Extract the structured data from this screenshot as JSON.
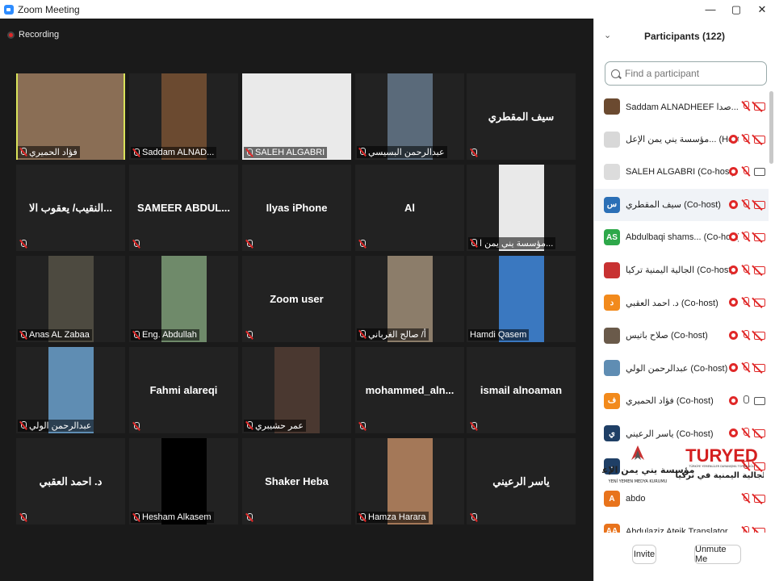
{
  "window": {
    "title": "Zoom Meeting",
    "minimize": "—",
    "maximize": "▢",
    "close": "✕"
  },
  "recording": {
    "label": "Recording"
  },
  "tiles": [
    {
      "name": "فؤاد الحميري",
      "kind": "photo",
      "photo": "#8a6e55",
      "active": true
    },
    {
      "name": "Saddam ALNAD...",
      "kind": "photo",
      "photo": "#6b4a30"
    },
    {
      "name": "SALEH ALGABRI",
      "kind": "slide",
      "photo": "#eaeaea"
    },
    {
      "name": "عبدالرحمن البسيسي",
      "kind": "photo",
      "photo": "#5a6a7a"
    },
    {
      "name": "سيف المقطري",
      "kind": "text"
    },
    {
      "name": "النقيب/ يعقوب الا...",
      "kind": "text"
    },
    {
      "name": "SAMEER ABDUL...",
      "kind": "text"
    },
    {
      "name": "Ilyas iPhone",
      "kind": "text"
    },
    {
      "name": "Al",
      "kind": "text"
    },
    {
      "name": "مؤسسة يني يمن ا...",
      "kind": "photo",
      "photo": "#e9e9e9"
    },
    {
      "name": "Anas AL Zabaa",
      "kind": "photo",
      "photo": "#4d4a40"
    },
    {
      "name": "Eng. Abdullah",
      "kind": "photo",
      "photo": "#6f8a6a"
    },
    {
      "name": "Zoom user",
      "kind": "text"
    },
    {
      "name": "أ/ صالح الغرباني",
      "kind": "photo",
      "photo": "#8c7d6a"
    },
    {
      "name": "Hamdi Qasem",
      "kind": "photo",
      "photo": "#3a78c0",
      "nomic": true
    },
    {
      "name": "عبدالرحمن الولي",
      "kind": "photo",
      "photo": "#5f8db3"
    },
    {
      "name": "Fahmi alareqi",
      "kind": "text"
    },
    {
      "name": "عمر حشيبري",
      "kind": "photo",
      "photo": "#4a3830"
    },
    {
      "name": "mohammed_aln...",
      "kind": "text"
    },
    {
      "name": "ismail alnoaman",
      "kind": "text"
    },
    {
      "name": "د. احمد العقبي",
      "kind": "text"
    },
    {
      "name": "Hesham Alkasem",
      "kind": "photo",
      "photo": "#000000"
    },
    {
      "name": "Shaker Heba",
      "kind": "text"
    },
    {
      "name": "Hamza Harara",
      "kind": "photo",
      "photo": "#a47858"
    },
    {
      "name": "ياسر الرعيني",
      "kind": "text"
    }
  ],
  "panel": {
    "title": "Participants (122)",
    "collapse_icon": "⌄",
    "search_placeholder": "Find a participant",
    "participants": [
      {
        "name": "Saddam ALNADHEEF صدا... (Me)",
        "avatar": "",
        "color": "#6b4a30",
        "hand": false,
        "mic": "off",
        "cam": "off"
      },
      {
        "name": "مؤسسة يني يمن الإعل... (Host)",
        "avatar": "",
        "color": "#d8d8d8",
        "hand": true,
        "mic": "off",
        "cam": "off"
      },
      {
        "name": "SALEH ALGABRI (Co-host)",
        "avatar": "",
        "color": "#dcdcdc",
        "hand": true,
        "mic": "off",
        "cam": "on"
      },
      {
        "name": "سيف المقطري (Co-host)",
        "avatar": "س",
        "color": "#2b6fb6",
        "hand": true,
        "mic": "off",
        "cam": "off",
        "sel": true
      },
      {
        "name": "Abdulbaqi shams... (Co-host)",
        "avatar": "AS",
        "color": "#2ea84a",
        "hand": true,
        "mic": "off",
        "cam": "off"
      },
      {
        "name": "الجالية اليمنية تركيا (Co-host)",
        "avatar": "",
        "color": "#c83232",
        "hand": true,
        "mic": "off",
        "cam": "off"
      },
      {
        "name": "د. احمد العقبي (Co-host)",
        "avatar": "د",
        "color": "#f28a1c",
        "hand": true,
        "mic": "off",
        "cam": "off"
      },
      {
        "name": "صلاح باتيس (Co-host)",
        "avatar": "",
        "color": "#6a5a4a",
        "hand": true,
        "mic": "off",
        "cam": "off"
      },
      {
        "name": "عبدالرحمن الولي (Co-host)",
        "avatar": "",
        "color": "#5f8db3",
        "hand": true,
        "mic": "off",
        "cam": "off"
      },
      {
        "name": "فؤاد الحميري (Co-host)",
        "avatar": "ف",
        "color": "#f28a1c",
        "hand": true,
        "mic": "on",
        "cam": "on"
      },
      {
        "name": "ياسر الرعيني (Co-host)",
        "avatar": "ي",
        "color": "#1f3f66",
        "hand": true,
        "mic": "off",
        "cam": "off"
      },
      {
        "name": "",
        "avatar": ".",
        "color": "#1f3f66",
        "hand": false,
        "mic": "off",
        "cam": "off"
      },
      {
        "name": "abdo",
        "avatar": "A",
        "color": "#e8731c",
        "hand": false,
        "mic": "off",
        "cam": "off"
      },
      {
        "name": "Abdulaziz Ateik Translator",
        "avatar": "AA",
        "color": "#e8731c",
        "hand": false,
        "mic": "off",
        "cam": "off"
      }
    ],
    "invite_label": "Invite",
    "unmute_label": "Unmute Me"
  },
  "watermark": {
    "left_logo": "مؤسسة يني يمن الإعلامية",
    "left_sub": "YENİ YEMEN MEDYA KURUMU",
    "right_logo": "TURYED",
    "right_sub": "الجالية اليمنية في تركيا",
    "right_tag": "TÜRKİYE YEMENLİLER DAYANIŞMA TOPLULUĞU"
  }
}
